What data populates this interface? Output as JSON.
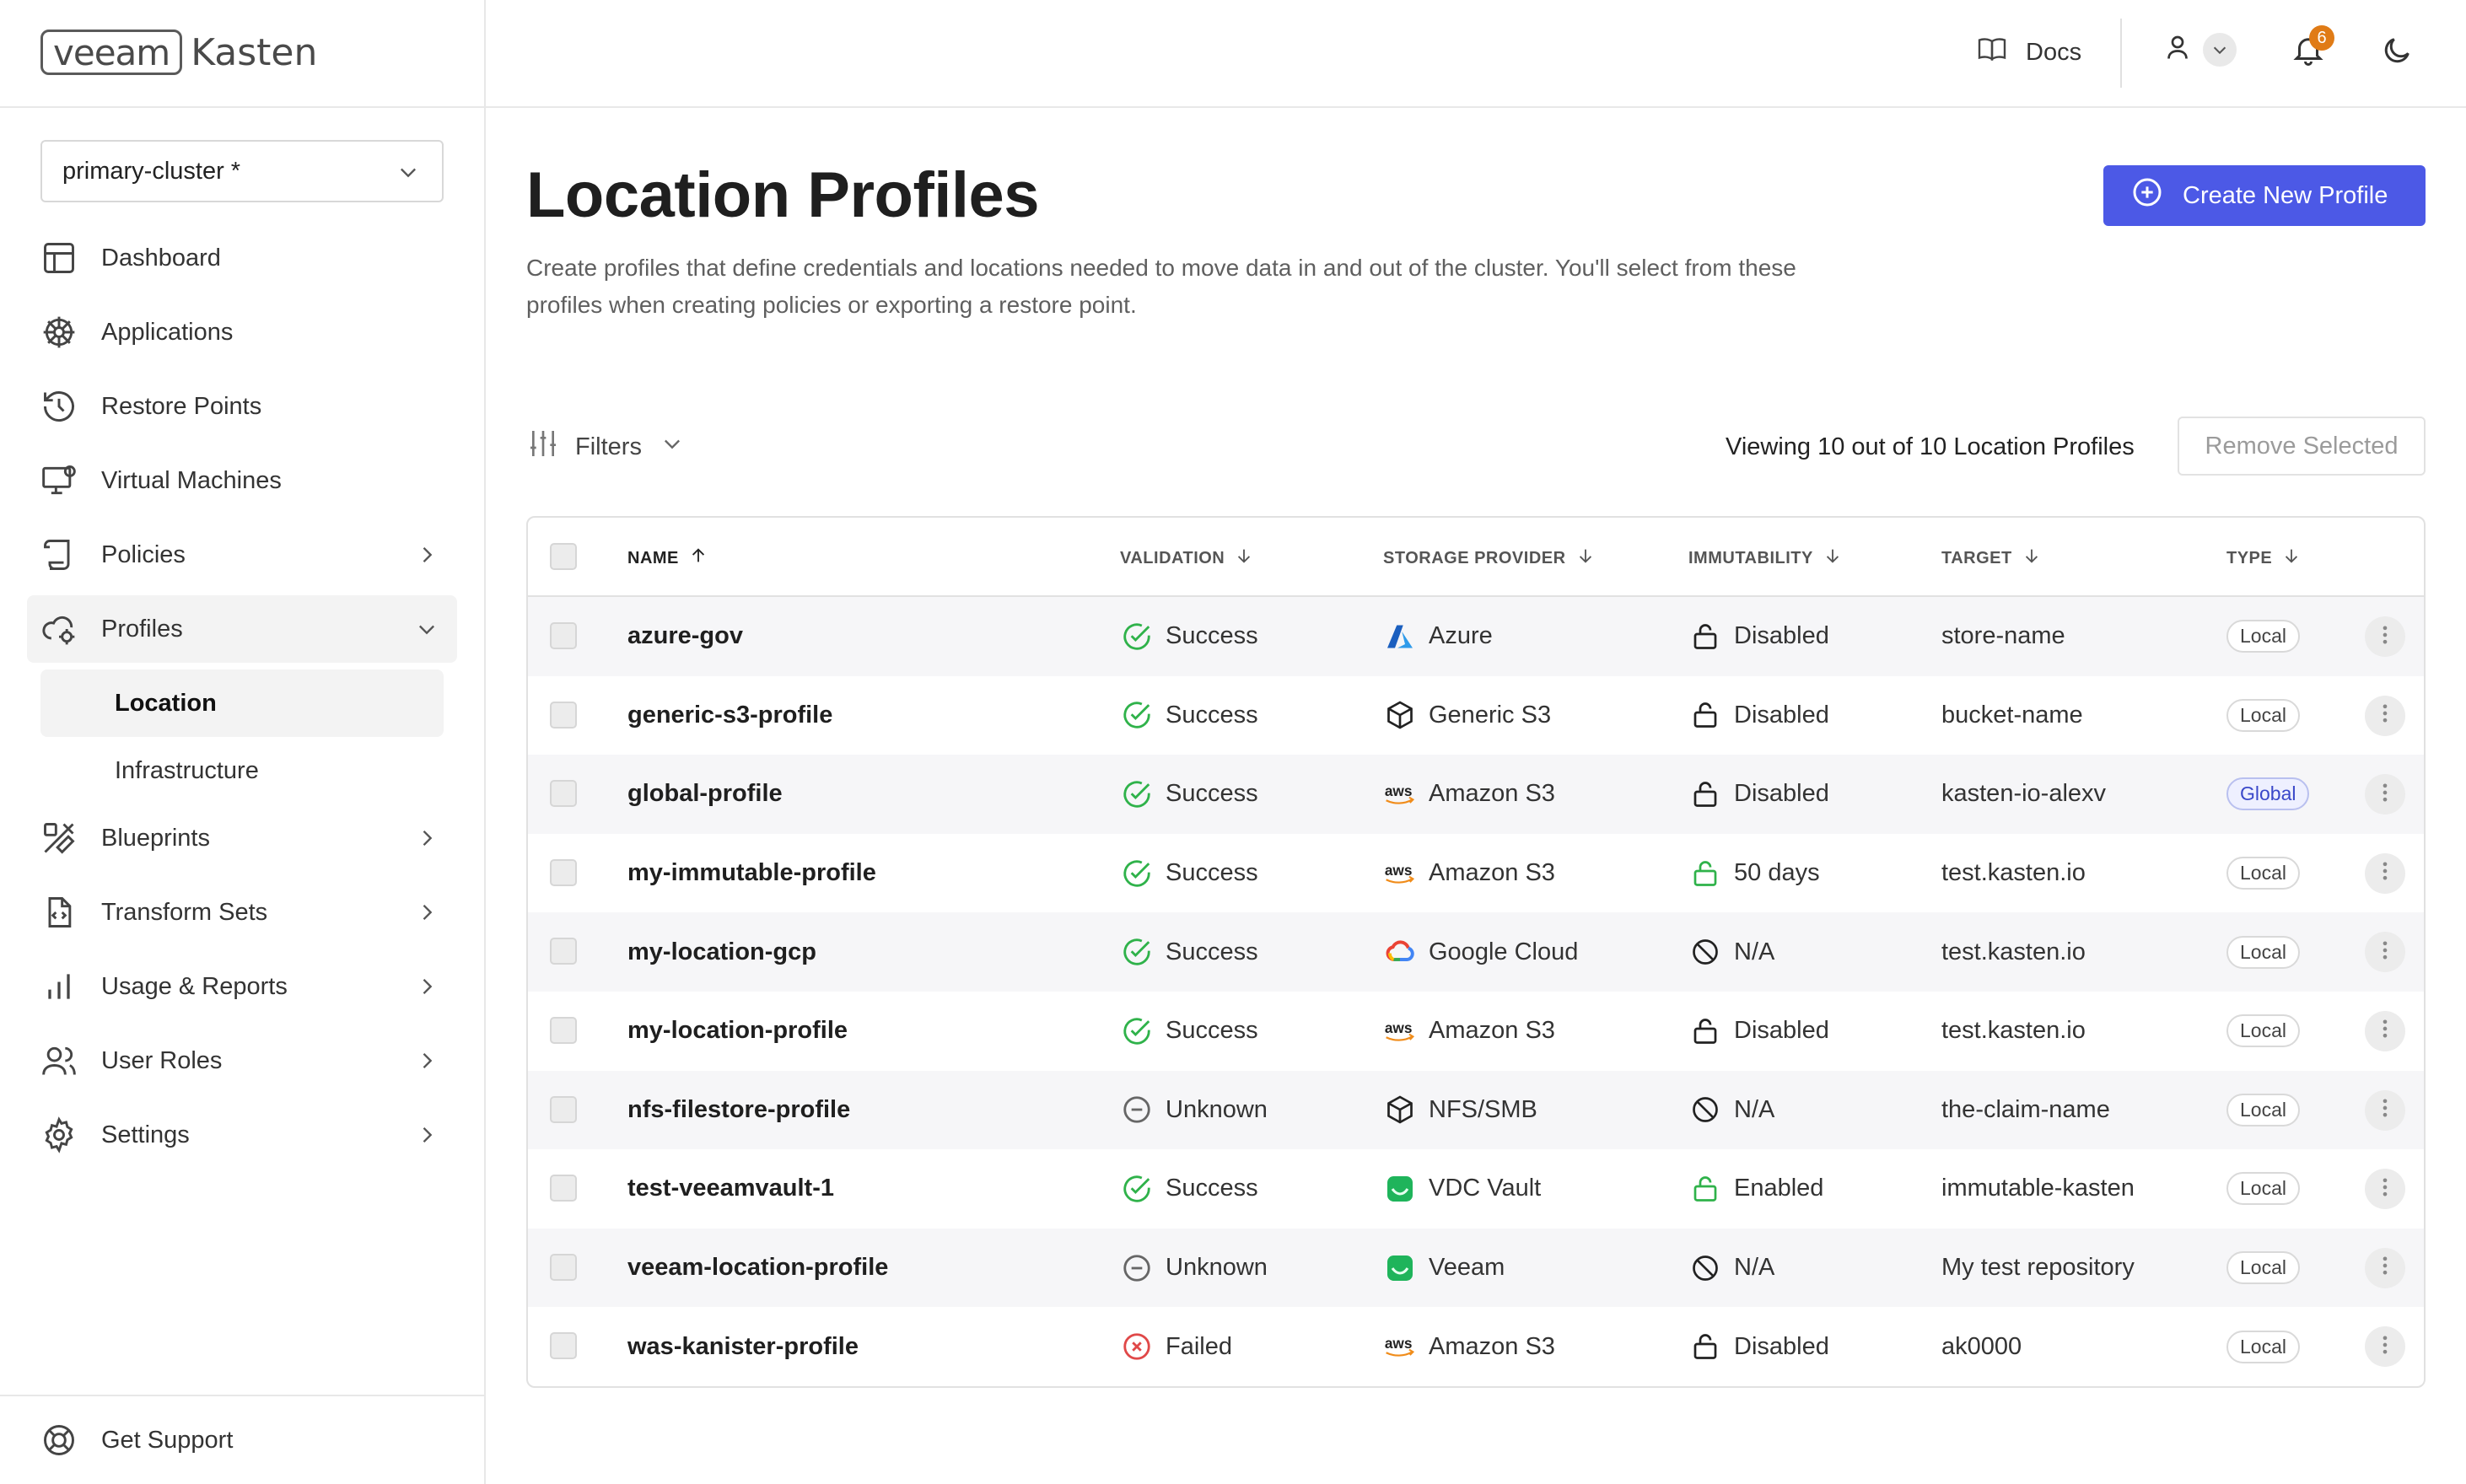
{
  "brand": {
    "logo_box": "veeam",
    "logo_text": "Kasten"
  },
  "cluster": {
    "value": "primary-cluster *"
  },
  "sidebar": {
    "items": [
      {
        "label": "Dashboard",
        "icon": "layout-icon"
      },
      {
        "label": "Applications",
        "icon": "helm-icon"
      },
      {
        "label": "Restore Points",
        "icon": "history-icon"
      },
      {
        "label": "Virtual Machines",
        "icon": "monitor-icon"
      },
      {
        "label": "Policies",
        "icon": "scroll-icon"
      },
      {
        "label": "Profiles",
        "icon": "cloud-gear-icon"
      },
      {
        "label": "Blueprints",
        "icon": "blueprint-icon"
      },
      {
        "label": "Transform Sets",
        "icon": "file-code-icon"
      },
      {
        "label": "Usage & Reports",
        "icon": "bar-chart-icon"
      },
      {
        "label": "User Roles",
        "icon": "users-icon"
      },
      {
        "label": "Settings",
        "icon": "gear-icon"
      }
    ],
    "sub_items": [
      {
        "label": "Location"
      },
      {
        "label": "Infrastructure"
      }
    ],
    "support": "Get Support"
  },
  "header": {
    "docs": "Docs",
    "notifications_count": "6"
  },
  "page": {
    "title": "Location Profiles",
    "description": "Create profiles that define credentials and locations needed to move data in and out of the cluster. You'll select from these profiles when creating policies or exporting a restore point.",
    "create_button": "Create New Profile"
  },
  "toolbar": {
    "filters": "Filters",
    "viewing": "Viewing 10 out of 10 Location Profiles",
    "remove_selected": "Remove Selected"
  },
  "table": {
    "columns": {
      "name": "NAME",
      "validation": "VALIDATION",
      "storage_provider": "STORAGE PROVIDER",
      "immutability": "IMMUTABILITY",
      "target": "TARGET",
      "type": "TYPE"
    },
    "rows": [
      {
        "name": "azure-gov",
        "validation": "Success",
        "provider": "Azure",
        "immutability": "Disabled",
        "target": "store-name",
        "type": "Local"
      },
      {
        "name": "generic-s3-profile",
        "validation": "Success",
        "provider": "Generic S3",
        "immutability": "Disabled",
        "target": "bucket-name",
        "type": "Local"
      },
      {
        "name": "global-profile",
        "validation": "Success",
        "provider": "Amazon S3",
        "immutability": "Disabled",
        "target": "kasten-io-alexv",
        "type": "Global"
      },
      {
        "name": "my-immutable-profile",
        "validation": "Success",
        "provider": "Amazon S3",
        "immutability": "50 days",
        "target": "test.kasten.io",
        "type": "Local"
      },
      {
        "name": "my-location-gcp",
        "validation": "Success",
        "provider": "Google Cloud",
        "immutability": "N/A",
        "target": "test.kasten.io",
        "type": "Local"
      },
      {
        "name": "my-location-profile",
        "validation": "Success",
        "provider": "Amazon S3",
        "immutability": "Disabled",
        "target": "test.kasten.io",
        "type": "Local"
      },
      {
        "name": "nfs-filestore-profile",
        "validation": "Unknown",
        "provider": "NFS/SMB",
        "immutability": "N/A",
        "target": "the-claim-name",
        "type": "Local"
      },
      {
        "name": "test-veeamvault-1",
        "validation": "Success",
        "provider": "VDC Vault",
        "immutability": "Enabled",
        "target": "immutable-kasten",
        "type": "Local"
      },
      {
        "name": "veeam-location-profile",
        "validation": "Unknown",
        "provider": "Veeam",
        "immutability": "N/A",
        "target": "My test repository",
        "type": "Local"
      },
      {
        "name": "was-kanister-profile",
        "validation": "Failed",
        "provider": "Amazon S3",
        "immutability": "Disabled",
        "target": "ak0000",
        "type": "Local"
      }
    ]
  },
  "colors": {
    "accent": "#4c59e6",
    "success": "#2fb24a",
    "failed": "#e04848",
    "badge": "#e07b16"
  }
}
